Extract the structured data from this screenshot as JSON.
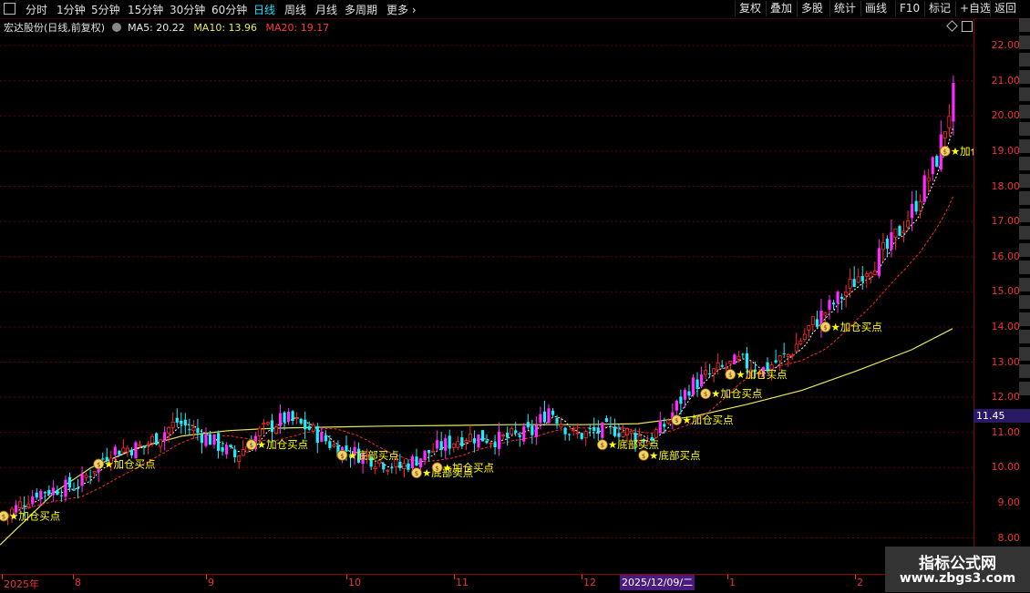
{
  "toolbar": {
    "timeframes": [
      "分时",
      "1分钟",
      "5分钟",
      "15分钟",
      "30分钟",
      "60分钟",
      "日线",
      "周线",
      "月线",
      "多周期",
      "更多"
    ],
    "active_timeframe": "日线",
    "right_buttons": [
      "复权",
      "叠加",
      "多股",
      "统计",
      "画线",
      "F10",
      "标记",
      "+自选",
      "返回"
    ]
  },
  "info": {
    "stock": "宏达股份(日线,前复权)",
    "ma5_label": "MA5: 20.22",
    "ma10_label": "MA10: 13.96",
    "ma20_label": "MA20: 19.17"
  },
  "colors": {
    "up": "#ff2a2a",
    "down": "#19f0ff",
    "signal_up": "#ff2bff",
    "ma5": "#ffffff",
    "ma20": "#ff2a2a",
    "ma_long": "#e8e85a",
    "signal_text": "#ffff00",
    "grid": "#6a0000"
  },
  "current_price_label": "11.45",
  "xaxis": {
    "ticks": [
      {
        "label": "2025年",
        "x": 4
      },
      {
        "label": "8",
        "x": 82
      },
      {
        "label": "9",
        "x": 228
      },
      {
        "label": "10",
        "x": 382
      },
      {
        "label": "11",
        "x": 500
      },
      {
        "label": "12",
        "x": 640
      },
      {
        "label": "1",
        "x": 800
      },
      {
        "label": "2",
        "x": 940
      }
    ],
    "cursor_label": "2025/12/09/二"
  },
  "watermark": {
    "title": "指标公式网",
    "url": "www.zbgs3.com"
  },
  "chart_data": {
    "type": "candlestick",
    "title": "",
    "yticks": [
      8.0,
      9.0,
      10.0,
      11.0,
      12.0,
      13.0,
      14.0,
      15.0,
      16.0,
      17.0,
      18.0,
      19.0,
      20.0,
      21.0,
      22.0
    ],
    "ytick_labels": [
      "8.00",
      "9.00",
      "10.00",
      "11.00",
      "12.00",
      "13.00",
      "14.00",
      "15.00",
      "16.00",
      "17.00",
      "18.00",
      "19.00",
      "20.00",
      "21.00",
      "22.00"
    ],
    "ylim": [
      7.8,
      23.0
    ],
    "grid": true,
    "signals": [
      {
        "label": "加仓买点",
        "index": 0,
        "price": 8.62
      },
      {
        "label": "加仓买点",
        "index": 23,
        "price": 10.1
      },
      {
        "label": "加仓买点",
        "index": 60,
        "price": 10.65
      },
      {
        "label": "底部买点",
        "index": 82,
        "price": 10.35
      },
      {
        "label": "底部买点",
        "index": 100,
        "price": 9.85
      },
      {
        "label": "加仓买点",
        "index": 105,
        "price": 10.0
      },
      {
        "label": "底部买点",
        "index": 145,
        "price": 10.65
      },
      {
        "label": "底部买点",
        "index": 155,
        "price": 10.35
      },
      {
        "label": "加仓买点",
        "index": 163,
        "price": 11.35
      },
      {
        "label": "加仓买点",
        "index": 170,
        "price": 12.1
      },
      {
        "label": "加仓买点",
        "index": 176,
        "price": 12.65
      },
      {
        "label": "加仓买点",
        "index": 199,
        "price": 14.0
      },
      {
        "label": "加仓买点",
        "index": 228,
        "price": 19.0
      }
    ]
  }
}
